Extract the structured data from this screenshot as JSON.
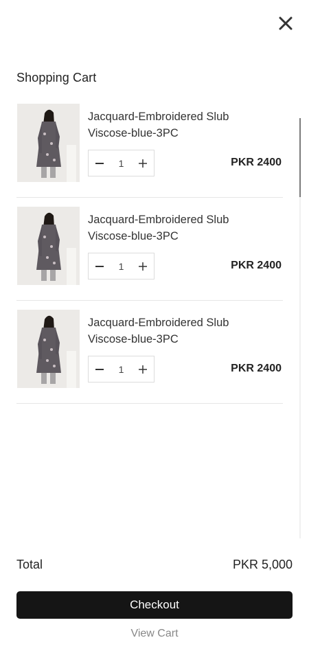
{
  "header": {
    "close_icon": "close-icon"
  },
  "cart": {
    "title": "Shopping Cart",
    "items": [
      {
        "name": "Jacquard-Embroidered Slub Viscose-blue-3PC",
        "quantity": "1",
        "price": "PKR 2400"
      },
      {
        "name": "Jacquard-Embroidered Slub Viscose-blue-3PC",
        "quantity": "1",
        "price": "PKR 2400"
      },
      {
        "name": "Jacquard-Embroidered Slub Viscose-blue-3PC",
        "quantity": "1",
        "price": "PKR 2400"
      }
    ]
  },
  "summary": {
    "total_label": "Total",
    "total_value": "PKR 5,000"
  },
  "actions": {
    "checkout_label": "Checkout",
    "view_cart_label": "View Cart"
  },
  "colors": {
    "checkout_bg": "#151515",
    "divider": "#e6e6e6",
    "muted_text": "#888888"
  }
}
